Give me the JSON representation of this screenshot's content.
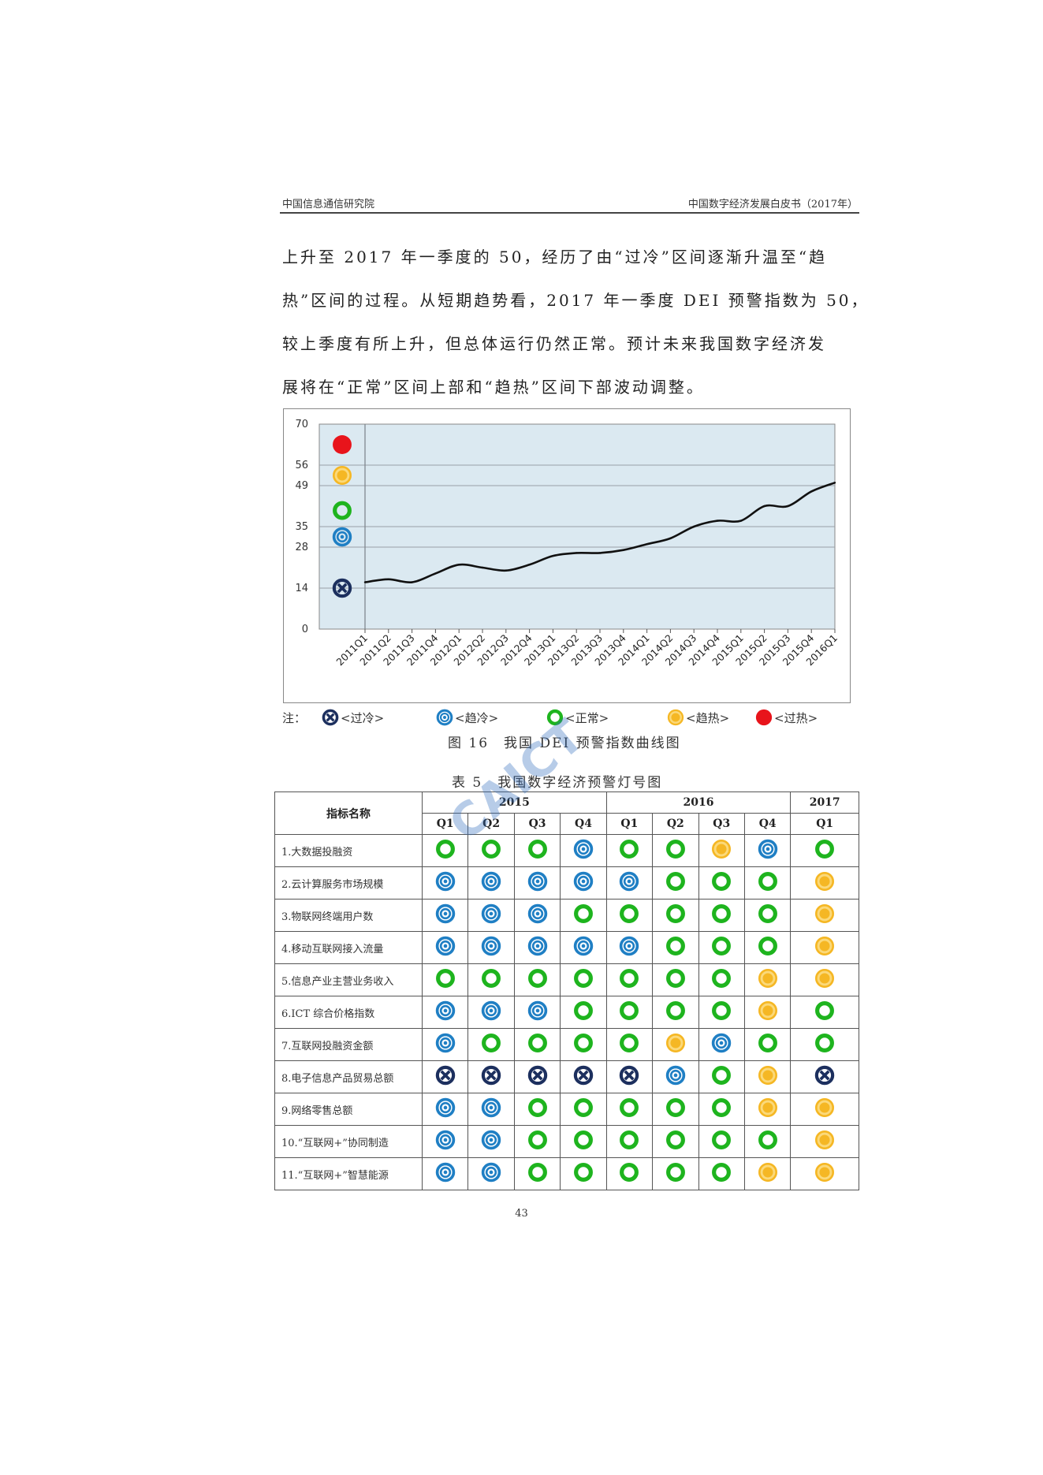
{
  "header": {
    "left": "中国信息通信研究院",
    "right": "中国数字经济发展白皮书（2017年）"
  },
  "body_text": [
    "上升至 2017 年一季度的 50，经历了由“过冷”区间逐渐升温至“趋",
    "热”区间的过程。从短期趋势看，2017 年一季度 DEI 预警指数为 50，",
    "较上季度有所上升，但总体运行仍然正常。预计未来我国数字经济发",
    "展将在“正常”区间上部和“趋热”区间下部波动调整。"
  ],
  "chart_data": {
    "type": "line",
    "title": "",
    "xlabel": "",
    "ylabel": "",
    "ylim": [
      0,
      70
    ],
    "yticks": [
      0,
      14,
      28,
      35,
      49,
      56,
      70
    ],
    "categories": [
      "2011Q1",
      "2011Q2",
      "2011Q3",
      "2011Q4",
      "2012Q1",
      "2012Q2",
      "2012Q3",
      "2012Q4",
      "2013Q1",
      "2013Q2",
      "2013Q3",
      "2013Q4",
      "2014Q1",
      "2014Q2",
      "2014Q3",
      "2014Q4",
      "2015Q1",
      "2015Q2",
      "2015Q3",
      "2015Q4",
      "2016Q1"
    ],
    "series": [
      {
        "values": [
          16,
          17,
          16,
          19,
          22,
          21,
          20,
          22,
          25,
          26,
          26,
          27,
          29,
          31,
          35,
          37,
          37,
          42,
          42,
          47,
          50
        ]
      }
    ],
    "zone_icons": [
      {
        "icon": "overheat",
        "y": 63
      },
      {
        "icon": "warm",
        "y": 52.5
      },
      {
        "icon": "normal",
        "y": 40.5
      },
      {
        "icon": "cool",
        "y": 31.5
      },
      {
        "icon": "overcold",
        "y": 14
      }
    ],
    "grid": true,
    "plot_background": "#dbe9f1",
    "line_color": "#111111"
  },
  "legend": {
    "prefix": "注：",
    "items": [
      {
        "icon": "overcold",
        "label": "<过冷>"
      },
      {
        "icon": "cool",
        "label": "<趋冷>"
      },
      {
        "icon": "normal",
        "label": "<正常>"
      },
      {
        "icon": "warm",
        "label": "<趋热>"
      },
      {
        "icon": "overheat",
        "label": "<过热>"
      }
    ]
  },
  "figure_caption": "图 16　我国 DEI 预警指数曲线图",
  "table_caption": "表 5　我国数字经济预警灯号图",
  "watermark": "CAICT",
  "table": {
    "header_name": "指标名称",
    "years": [
      {
        "label": "2015",
        "span": 4
      },
      {
        "label": "2016",
        "span": 4
      },
      {
        "label": "2017",
        "span": 1
      }
    ],
    "quarters": [
      "Q1",
      "Q2",
      "Q3",
      "Q4",
      "Q1",
      "Q2",
      "Q3",
      "Q4",
      "Q1"
    ],
    "rows": [
      {
        "name": "1.大数据投融资",
        "signals": [
          "normal",
          "normal",
          "normal",
          "cool",
          "normal",
          "normal",
          "warm",
          "cool",
          "normal"
        ]
      },
      {
        "name": "2.云计算服务市场规模",
        "signals": [
          "cool",
          "cool",
          "cool",
          "cool",
          "cool",
          "normal",
          "normal",
          "normal",
          "warm"
        ]
      },
      {
        "name": "3.物联网终端用户数",
        "signals": [
          "cool",
          "cool",
          "cool",
          "normal",
          "normal",
          "normal",
          "normal",
          "normal",
          "warm"
        ]
      },
      {
        "name": "4.移动互联网接入流量",
        "signals": [
          "cool",
          "cool",
          "cool",
          "cool",
          "cool",
          "normal",
          "normal",
          "normal",
          "warm"
        ]
      },
      {
        "name": "5.信息产业主营业务收入",
        "signals": [
          "normal",
          "normal",
          "normal",
          "normal",
          "normal",
          "normal",
          "normal",
          "warm",
          "warm"
        ]
      },
      {
        "name": "6.ICT 综合价格指数",
        "signals": [
          "cool",
          "cool",
          "cool",
          "normal",
          "normal",
          "normal",
          "normal",
          "warm",
          "normal"
        ]
      },
      {
        "name": "7.互联网投融资金额",
        "signals": [
          "cool",
          "normal",
          "normal",
          "normal",
          "normal",
          "warm",
          "cool",
          "normal",
          "normal"
        ]
      },
      {
        "name": "8.电子信息产品贸易总额",
        "signals": [
          "overcold",
          "overcold",
          "overcold",
          "overcold",
          "overcold",
          "cool",
          "normal",
          "warm",
          "overcold"
        ]
      },
      {
        "name": "9.网络零售总额",
        "signals": [
          "cool",
          "cool",
          "normal",
          "normal",
          "normal",
          "normal",
          "normal",
          "warm",
          "warm"
        ]
      },
      {
        "name": "10.“互联网+”协同制造",
        "signals": [
          "cool",
          "cool",
          "normal",
          "normal",
          "normal",
          "normal",
          "normal",
          "normal",
          "warm"
        ]
      },
      {
        "name": "11.“互联网+”智慧能源",
        "signals": [
          "cool",
          "cool",
          "normal",
          "normal",
          "normal",
          "normal",
          "normal",
          "warm",
          "warm"
        ]
      }
    ]
  },
  "colors": {
    "overheat": "#e8141b",
    "warm": "#f5b724",
    "normal": "#1eb41e",
    "cool": "#1f7fc4",
    "overcold": "#1c2f5e"
  },
  "page_number": "43"
}
